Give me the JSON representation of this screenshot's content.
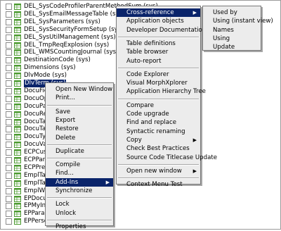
{
  "tree": {
    "items": [
      "DEL_SysCodeProfilerParentMethodSum (sys)",
      "DEL_SysEmailMessageTable (sys)",
      "DEL_SysParameters (sys)",
      "DEL_SysSecurityFormSetup (sys)",
      "DEL_SysUtilManagement (sys)",
      "DEL_TmpReqExplosion (sys)",
      "DEL_WMSCountingJournal (sys)",
      "DestinationCode (sys)",
      "Dimensions (sys)",
      "DlvMode (sys)",
      "DlvTerm (sys)",
      "DocuField",
      "DocuOpen",
      "DocuParam",
      "DocuRef",
      "DocuTable",
      "DocuTable",
      "DocuType",
      "DocuValue",
      "ECPCustS",
      "ECPParam",
      "ECPPrese",
      "EmplTable",
      "EmplTask",
      "EmplWork",
      "EPDocuPa",
      "EPMyInfo",
      "EPParame",
      "EPPersonalize (sys)"
    ],
    "selected_index": 10,
    "expander_glyph": "+"
  },
  "context_menu": {
    "items": [
      "Open New Window",
      "Print...",
      "Save",
      "Export",
      "Restore",
      "Delete",
      "Duplicate",
      "Compile",
      "Find...",
      "Add-Ins",
      "Synchronize",
      "Lock",
      "Unlock",
      "Properties"
    ]
  },
  "addins_menu": {
    "items": [
      "Cross-reference",
      "Application objects",
      "Developer Documentation",
      "Table definitions",
      "Table browser",
      "Auto-report",
      "Code Explorer",
      "Visual MorphXplorer",
      "Application Hierarchy Tree",
      "Compare",
      "Code upgrade",
      "Find and replace",
      "Syntactic renaming",
      "Copy",
      "Check Best Practices",
      "Source Code Titlecase Update",
      "Open new window",
      "Context Menu Test"
    ]
  },
  "crossref_menu": {
    "items": [
      "Used by",
      "Using (instant view)",
      "Names",
      "Using",
      "Update"
    ]
  },
  "submenu_arrow": "▶",
  "colors": {
    "highlight": "#0a246a",
    "menu_bg": "#ececec",
    "table_icon_green": "#4b9a2f"
  }
}
